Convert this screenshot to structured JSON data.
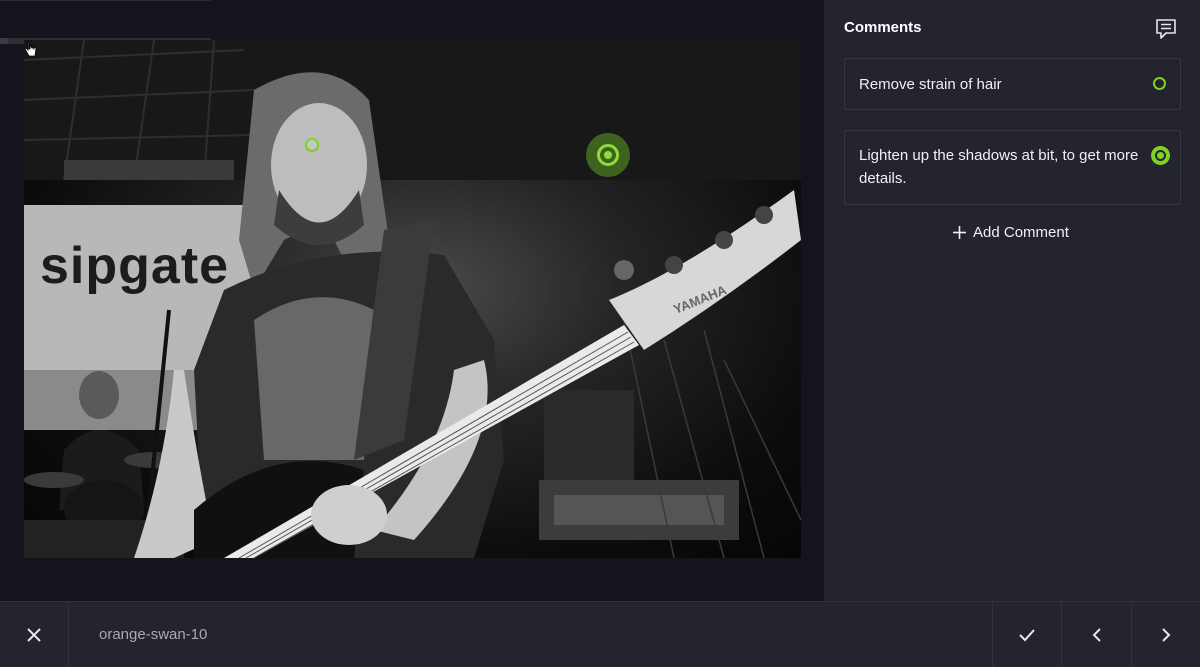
{
  "viewer": {
    "progress_fraction": 0.04,
    "photo": {
      "banner_text": "sipgate",
      "brand_text": "YAMAHA"
    },
    "markers": [
      {
        "name": "marker-1",
        "state": "open"
      },
      {
        "name": "marker-2",
        "state": "active"
      }
    ]
  },
  "panel": {
    "title": "Comments",
    "icon": "comment-icon",
    "comments": [
      {
        "text": "Remove strain of hair",
        "status": "open"
      },
      {
        "text": "Lighten up the shadows at bit, to get more details.",
        "status": "active"
      }
    ],
    "add_label": "Add Comment"
  },
  "toolbar": {
    "filename": "orange-swan-10",
    "icons": {
      "close": "close-icon",
      "approve": "check-icon",
      "previous": "chevron-left-icon",
      "next": "chevron-right-icon"
    }
  },
  "colors": {
    "accent": "#7ed321",
    "background": "#14151c",
    "panel": "#23242d"
  }
}
